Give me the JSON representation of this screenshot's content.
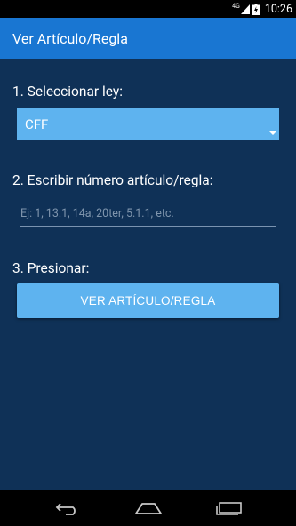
{
  "status_bar": {
    "network": "4G",
    "time": "10:26"
  },
  "app_bar": {
    "title": "Ver Artículo/Regla"
  },
  "steps": {
    "step1_label": "1. Seleccionar ley:",
    "law_selected": "CFF",
    "step2_label": "2. Escribir número artículo/regla:",
    "article_placeholder": "Ej: 1, 13.1, 14a, 20ter, 5.1.1, etc.",
    "article_value": "",
    "step3_label": "3. Presionar:",
    "button_label": "VER ARTÍCULO/REGLA"
  },
  "nav": {
    "icons": [
      "back-icon",
      "home-icon",
      "recent-apps-icon"
    ]
  },
  "colors": {
    "background": "#0f3157",
    "app_bar": "#1976d2",
    "accent": "#5eb3ef"
  }
}
